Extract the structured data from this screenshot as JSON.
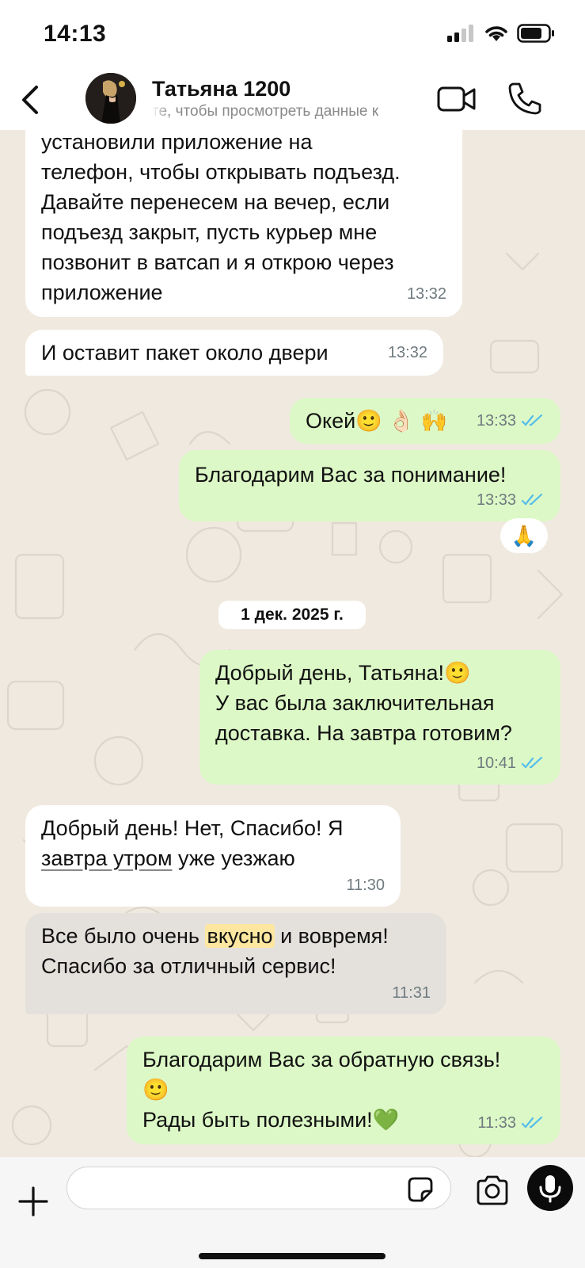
{
  "status_bar": {
    "time": "14:13"
  },
  "header": {
    "contact_name": "Татьяна 1200",
    "subtitle": "те, чтобы просмотреть данные к"
  },
  "messages": [
    {
      "id": "m1",
      "direction": "in",
      "lines": [
        "установили приложение на",
        "телефон, чтобы открывать подъезд.",
        "Давайте перенесем на вечер, если",
        "подъезд закрыт, пусть курьер мне",
        "позвонит в ватсап и я открою через",
        "приложение"
      ],
      "time": "13:32"
    },
    {
      "id": "m2",
      "direction": "in",
      "lines": [
        "И оставит пакет около двери"
      ],
      "time": "13:32"
    },
    {
      "id": "m3",
      "direction": "out",
      "text": "Окей🙂 👌🏻 🙌",
      "time": "13:33",
      "read": true
    },
    {
      "id": "m4",
      "direction": "out",
      "text": "Благодарим Вас за понимание!",
      "time": "13:33",
      "read": true,
      "reaction": "🙏"
    },
    {
      "id": "m5",
      "direction": "out",
      "lines": [
        "Добрый день, Татьяна!🙂",
        "У вас была заключительная",
        "доставка. На завтра готовим?"
      ],
      "time": "10:41",
      "read": true
    },
    {
      "id": "m6",
      "direction": "in",
      "line1": "Добрый день! Нет, Спасибо! Я",
      "line2_underlined": "завтра утром",
      "line2_rest": " уже уезжаю",
      "time": "11:30"
    },
    {
      "id": "m7",
      "direction": "in",
      "line1_before": "Все было очень ",
      "line1_highlight": "вкусно",
      "line1_after": " и вовремя!",
      "line2": "Спасибо за отличный сервис!",
      "time": "11:31"
    },
    {
      "id": "m8",
      "direction": "out",
      "lines": [
        "Благодарим Вас за обратную связь!",
        "🙂",
        "Рады быть полезными!💚"
      ],
      "time": "11:33",
      "read": true
    }
  ],
  "date_separator": "1 дек. 2025 г.",
  "composer": {
    "placeholder": ""
  },
  "colors": {
    "outgoing": "#dcf8c6",
    "incoming": "#ffffff",
    "read_ticks": "#53bdeb",
    "wallpaper": "#efe9df"
  }
}
